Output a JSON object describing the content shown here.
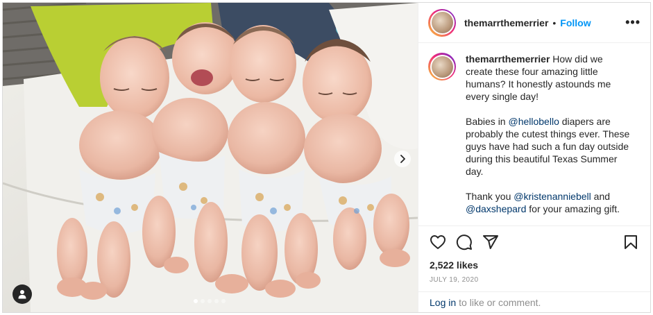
{
  "post": {
    "username": "themarrthemerrier",
    "separator": "•",
    "follow_label": "Follow",
    "more_icon": "•••",
    "caption": {
      "username": "themarrthemerrier",
      "para1": "How did we create these four amazing little humans? It honestly astounds me every single day!",
      "para2_before": "Babies in",
      "para2_mention": "@hellobello",
      "para2_after": "diapers are probably the cutest things ever. These guys have had such a fun day outside during this beautiful Texas Summer day.",
      "para3_before": "Thank you",
      "para3_mention1": "@kristenanniebell",
      "para3_and": "and",
      "para3_mention2": "@daxshepard",
      "para3_after": "for your amazing gift."
    },
    "likes": "2,522 likes",
    "date": "JULY 19, 2020",
    "login_link": "Log in",
    "login_rest": "to like or comment."
  },
  "icons": {
    "like": "heart-icon",
    "comment": "comment-icon",
    "share": "share-icon",
    "save": "bookmark-icon",
    "next": "chevron-right-icon",
    "tag": "user-tag-icon"
  },
  "carousel": {
    "slides": 5,
    "active": 0
  },
  "colors": {
    "follow": "#0095f6",
    "mention": "#00376b",
    "muted": "#8e8e8e"
  }
}
